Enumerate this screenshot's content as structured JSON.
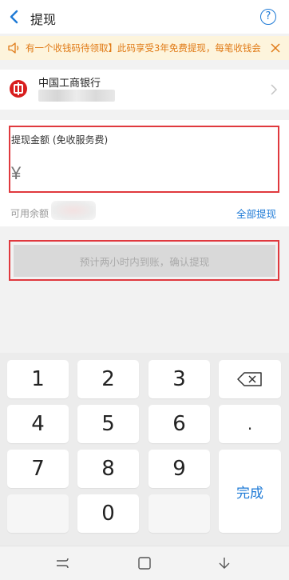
{
  "header": {
    "title": "提现",
    "help_label": "?"
  },
  "notice": {
    "text": "有一个收钱码待领取】此码享受3年免费提现，每笔收钱会"
  },
  "bank": {
    "name": "中国工商银行"
  },
  "amount": {
    "label": "提现金额 (免收服务费)",
    "currency": "¥",
    "value": ""
  },
  "balance": {
    "label": "可用余额",
    "withdraw_all": "全部提现"
  },
  "confirm": {
    "label": "预计两小时内到账，确认提现"
  },
  "keypad": {
    "keys": [
      "1",
      "2",
      "3",
      "4",
      "5",
      "6",
      "7",
      "8",
      "9",
      "0"
    ],
    "dot": ".",
    "done": "完成"
  },
  "colors": {
    "accent": "#1e7ad6",
    "notice_text": "#e07a16",
    "notice_bg": "#fdf4dc",
    "highlight_border": "#e0393e",
    "bank_logo": "#d81e1e"
  },
  "icons": {
    "back": "chevron-left-icon",
    "help": "question-circle-icon",
    "notice": "speaker-icon",
    "close": "close-icon",
    "bank": "icbc-logo-icon",
    "card_arrow": "chevron-right-icon",
    "backspace": "backspace-icon",
    "nav_back": "nav-back-icon",
    "nav_home": "nav-home-icon",
    "nav_recent": "nav-recent-icon"
  }
}
